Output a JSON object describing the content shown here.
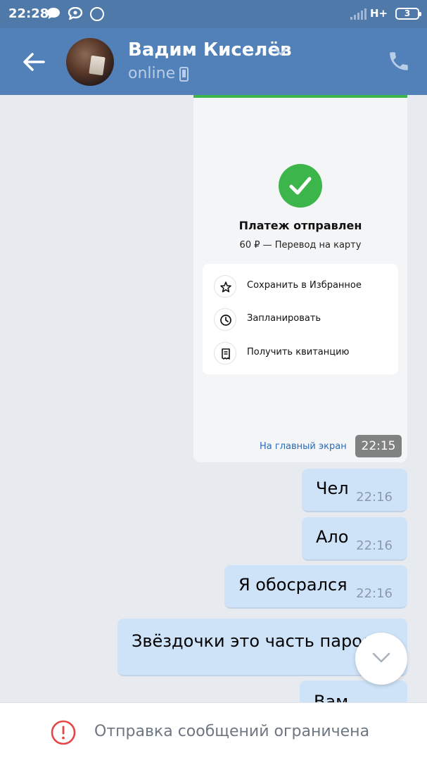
{
  "status_bar": {
    "time": "22:28",
    "network": "H+",
    "battery": "3",
    "icons": [
      "chat-bubble-icon",
      "message-icon",
      "circle-icon",
      "signal-icon"
    ]
  },
  "header": {
    "contact_name": "Вадим Киселёв",
    "status": "online",
    "icons": [
      "back-arrow-icon",
      "chevron-down-icon",
      "mobile-device-icon",
      "phone-icon"
    ],
    "colors": {
      "header_bg": "#5181b8",
      "status_bar_bg": "#4f79a8"
    }
  },
  "payment_card": {
    "title": "Платеж отправлен",
    "subtitle": "60 ₽ — Перевод на карту",
    "actions": [
      {
        "label": "Сохранить в Избранное",
        "icon": "star-icon"
      },
      {
        "label": "Запланировать",
        "icon": "clock-icon"
      },
      {
        "label": "Получить квитанцию",
        "icon": "receipt-icon"
      }
    ],
    "home_link": "На главный экран",
    "time": "22:15",
    "accent_color": "#3cb54a"
  },
  "messages": [
    {
      "text": "Чел",
      "time": "22:16"
    },
    {
      "text": "Ало",
      "time": "22:16"
    },
    {
      "text": "Я обосрался",
      "time": "22:16"
    },
    {
      "text": "Звёздочки это часть пароля?",
      "time": ""
    },
    {
      "text": "Вам",
      "time": ""
    }
  ],
  "bottom_bar": {
    "text": "Отправка сообщений ограничена",
    "icon": "warning-icon",
    "icon_color": "#e64646"
  }
}
